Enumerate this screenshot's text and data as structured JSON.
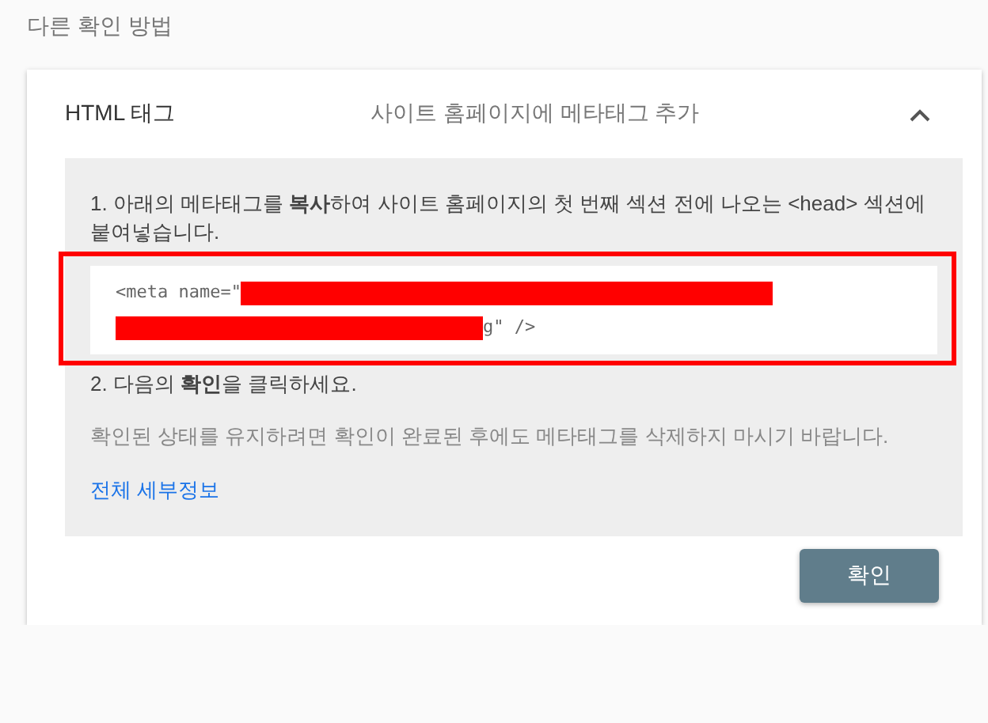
{
  "section_title": "다른 확인 방법",
  "method": {
    "title": "HTML 태그",
    "subtitle": "사이트 홈페이지에 메타태그 추가",
    "expanded": true,
    "steps": [
      {
        "kind": "instruction",
        "text": "1. 아래의 메타태그를 **복사**하여 사이트 홈페이지의 첫 번째 섹션 전에 나오는 <head> 섹션에 붙여넣습니다."
      },
      {
        "kind": "code",
        "highlighted": true,
        "lines": [
          {
            "segments": [
              {
                "kind": "text",
                "text": "<meta name=\""
              },
              {
                "kind": "redaction"
              }
            ]
          },
          {
            "segments": [
              {
                "kind": "redaction"
              },
              {
                "kind": "text",
                "text": "g\" />"
              }
            ]
          }
        ]
      },
      {
        "kind": "instruction",
        "text": "2. 다음의 **확인**을 클릭하세요."
      },
      {
        "kind": "note",
        "text": "확인된 상태를 유지하려면 확인이 완료된 후에도 메타태그를 삭제하지 마시기 바랍니다."
      },
      {
        "kind": "link",
        "text": "전체 세부정보"
      }
    ],
    "button": "확인"
  }
}
